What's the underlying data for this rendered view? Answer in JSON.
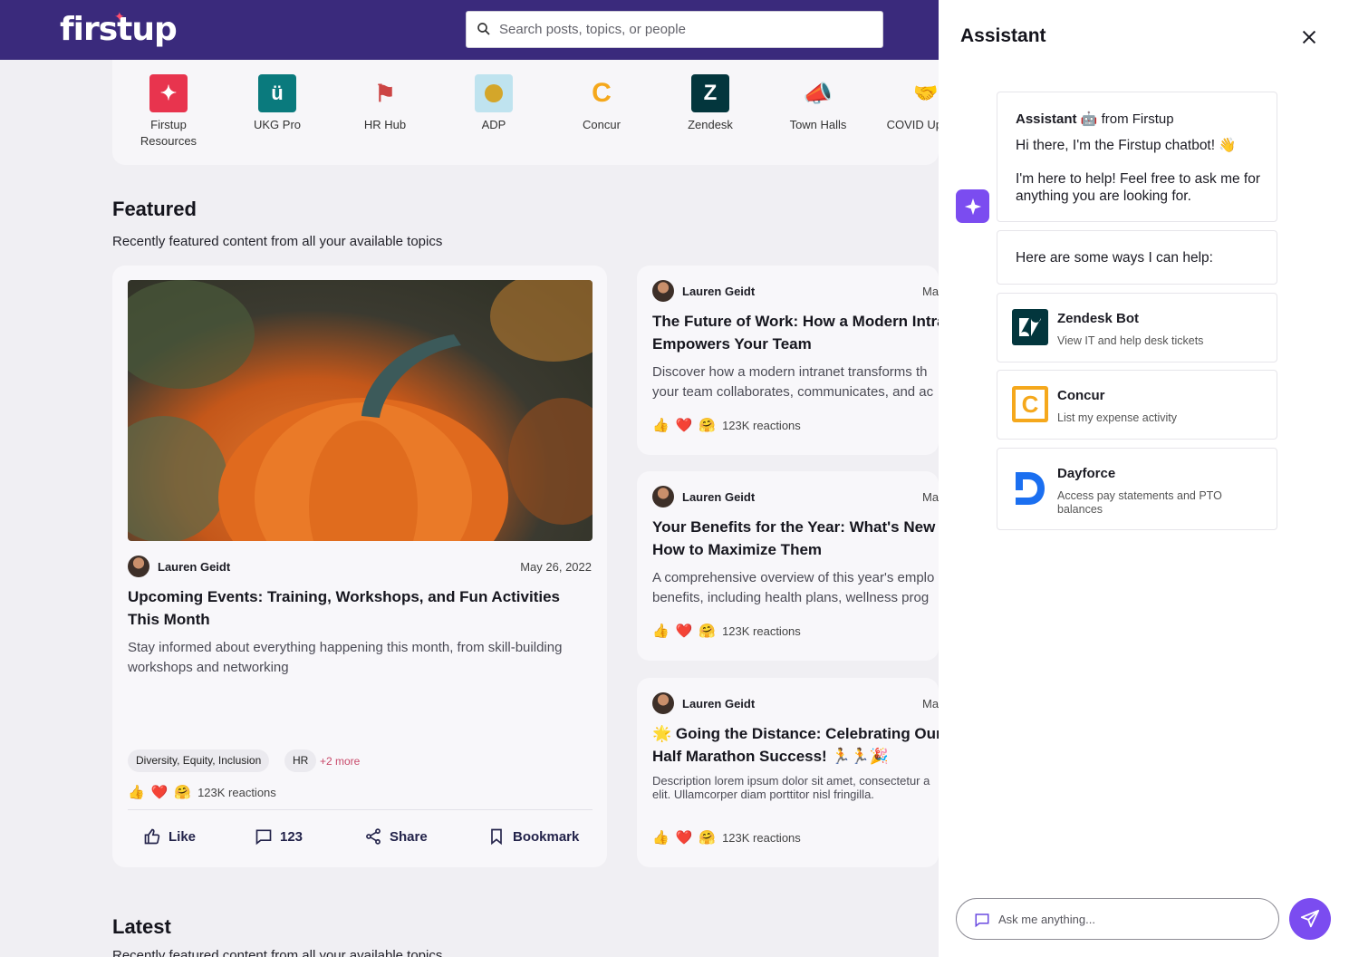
{
  "header": {
    "logo": "firstup",
    "search_placeholder": "Search posts, topics, or people"
  },
  "apps": [
    {
      "label": "Firstup Resources",
      "icon": "firstup-star-icon",
      "color": "#e8344e"
    },
    {
      "label": "UKG Pro",
      "icon": "ukg-icon",
      "color": "#0a7a7d"
    },
    {
      "label": "HR Hub",
      "icon": "hr-hub-icon",
      "color": "#ffffff"
    },
    {
      "label": "ADP",
      "icon": "adp-icon",
      "color": "#bfe3ef"
    },
    {
      "label": "Concur",
      "icon": "concur-icon",
      "color": "#f5a81c"
    },
    {
      "label": "Zendesk",
      "icon": "zendesk-icon",
      "color": "#03363d"
    },
    {
      "label": "Town Halls",
      "icon": "megaphone-icon",
      "color": "#ffffff"
    },
    {
      "label": "COVID Update",
      "icon": "covid-update-icon",
      "color": "#ffffff"
    }
  ],
  "featured": {
    "title": "Featured",
    "subtitle": "Recently featured content from all your available topics",
    "main_post": {
      "author": "Lauren Geidt",
      "date": "May 26, 2022",
      "title": "Upcoming Events: Training, Workshops, and Fun Activities This Month",
      "description": "Stay informed about everything happening this month, from skill-building workshops and networking",
      "tags": [
        "Diversity, Equity, Inclusion",
        "HR"
      ],
      "more": "+2 more",
      "reactions": "123K reactions",
      "actions": {
        "like": "Like",
        "comments": "123",
        "share": "Share",
        "bookmark": "Bookmark"
      }
    },
    "side_posts": [
      {
        "author": "Lauren Geidt",
        "date": "Ma",
        "title": "The Future of Work: How a Modern Intra Empowers Your Team",
        "description": "Discover how a modern intranet transforms th your team collaborates, communicates, and ac",
        "reactions": "123K reactions"
      },
      {
        "author": "Lauren Geidt",
        "date": "Ma",
        "title": "Your Benefits for the Year: What's New a How to Maximize Them",
        "description": "A comprehensive overview of this year's emplo benefits, including health plans, wellness prog",
        "reactions": "123K reactions"
      },
      {
        "author": "Lauren Geidt",
        "date": "Ma",
        "title": "🌟 Going the Distance: Celebrating Our Half Marathon Success! 🏃🏃🎉",
        "description": "Description lorem ipsum dolor sit amet, consectetur a elit. Ullamcorper diam porttitor nisl fringilla.",
        "reactions": "123K reactions"
      }
    ]
  },
  "latest": {
    "title": "Latest",
    "subtitle": "Recently featured content from all your available topics"
  },
  "assistant": {
    "title": "Assistant",
    "greeting_sender": "Assistant",
    "greeting_from": "from Firstup",
    "greeting_line1": "Hi there, I'm the Firstup chatbot! 👋",
    "greeting_line2": "I'm here to help! Feel free to ask me for anything you are looking for.",
    "help_intro": "Here are some ways I can help:",
    "tools": [
      {
        "name": "Zendesk Bot",
        "description": "View IT and help desk tickets",
        "icon": "zendesk-icon"
      },
      {
        "name": "Concur",
        "description": "List my expense activity",
        "icon": "concur-icon"
      },
      {
        "name": "Dayforce",
        "description": "Access pay statements and PTO balances",
        "icon": "dayforce-icon"
      }
    ],
    "input_placeholder": "Ask me anything..."
  }
}
